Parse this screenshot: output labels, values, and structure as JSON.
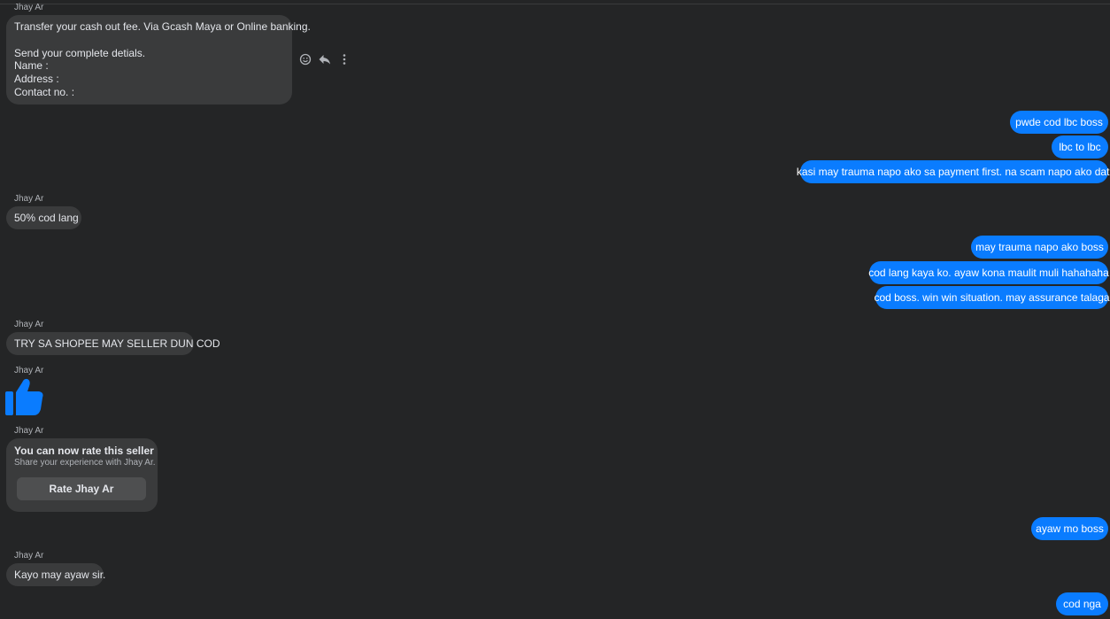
{
  "colors": {
    "background": "#242526",
    "incoming_bubble": "#3a3b3c",
    "outgoing_bubble": "#0a7cff",
    "like_icon": "#0a7cff"
  },
  "chat": {
    "sender_name": "Jhay Ar",
    "msg1_text": "Transfer your cash out fee. Via Gcash Maya or Online banking.\n\nSend your complete detials.\nName :\nAddress :\nContact no. :",
    "out1": "pwde cod lbc boss",
    "out2": "lbc to lbc",
    "out3": "kasi may trauma napo ako sa payment first. na scam napo ako dati",
    "msg2_text": "50% cod lang",
    "out4": "may trauma napo ako boss",
    "out5": "cod lang kaya ko. ayaw kona maulit muli hahahaha",
    "out6": "cod boss. win win situation. may assurance talaga",
    "msg3_text": "TRY SA SHOPEE MAY SELLER DUN COD",
    "like_icon": "thumbs-up-icon",
    "rate_title": "You can now rate this seller",
    "rate_subtitle": "Share your experience with Jhay Ar.",
    "rate_button": "Rate Jhay Ar",
    "out7": "ayaw mo boss",
    "msg4_text": "Kayo may ayaw sir.",
    "out8": "cod nga"
  },
  "hover_actions": {
    "icons": [
      "emoji-icon",
      "reply-icon",
      "more-options-icon"
    ]
  }
}
